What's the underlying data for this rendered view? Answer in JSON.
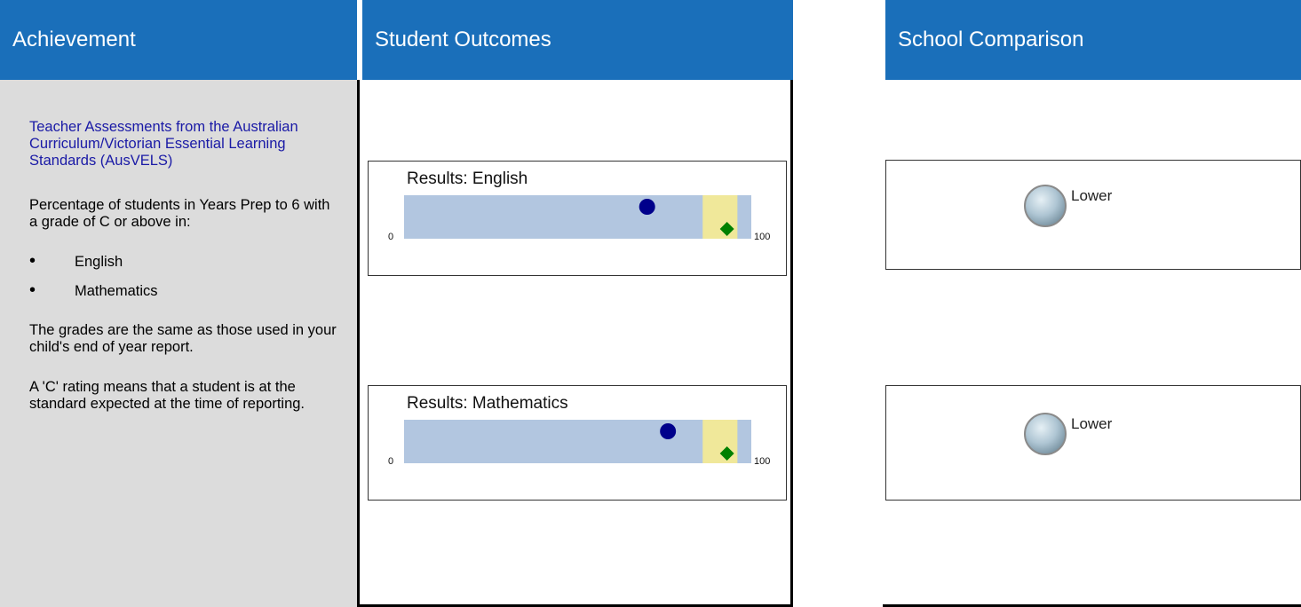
{
  "headers": {
    "achievement": "Achievement",
    "student_outcomes": "Student Outcomes",
    "school_comparison": "School Comparison"
  },
  "achievement": {
    "title": "Teacher Assessments from the Australian Curriculum/Victorian Essential Learning Standards (AusVELS)",
    "para1": "Percentage of students in Years Prep to 6 with a grade of C or above in:",
    "bullets": [
      "English",
      "Mathematics"
    ],
    "para2": "The grades are the same as those used in your child's end of year report.",
    "para3": "A 'C' rating means that a student is at the standard expected at the time of reporting."
  },
  "chart_data": [
    {
      "type": "bar",
      "title": "Results: English",
      "xlim": [
        0,
        100
      ],
      "min_label": "0",
      "max_label": "100",
      "school_result": 70,
      "similar_schools_range": [
        86,
        96
      ],
      "state_median": 93
    },
    {
      "type": "bar",
      "title": "Results: Mathematics",
      "xlim": [
        0,
        100
      ],
      "min_label": "0",
      "max_label": "100",
      "school_result": 76,
      "similar_schools_range": [
        86,
        96
      ],
      "state_median": 93
    }
  ],
  "comparison": [
    {
      "label": "Lower"
    },
    {
      "label": "Lower"
    }
  ],
  "colors": {
    "header_bg": "#1a6fba",
    "bar_bg": "#b2c6e0",
    "range_band": "#f0e89a",
    "school_marker": "#00008b",
    "median_marker": "#008000"
  }
}
